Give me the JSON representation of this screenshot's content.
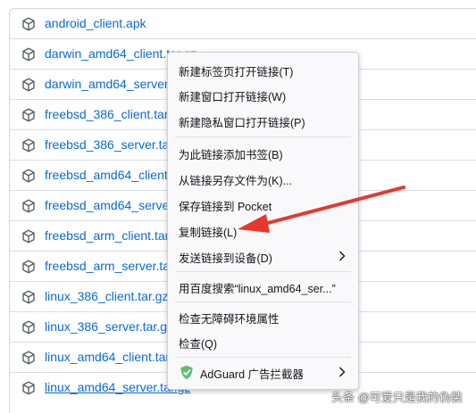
{
  "files": [
    {
      "name": "android_client.apk"
    },
    {
      "name": "darwin_amd64_client.tar.gz"
    },
    {
      "name": "darwin_amd64_server.tar.gz"
    },
    {
      "name": "freebsd_386_client.tar.gz"
    },
    {
      "name": "freebsd_386_server.tar.gz"
    },
    {
      "name": "freebsd_amd64_client.tar.gz"
    },
    {
      "name": "freebsd_amd64_server.tar.gz"
    },
    {
      "name": "freebsd_arm_client.tar.gz"
    },
    {
      "name": "freebsd_arm_server.tar.gz"
    },
    {
      "name": "linux_386_client.tar.gz"
    },
    {
      "name": "linux_386_server.tar.gz"
    },
    {
      "name": "linux_amd64_client.tar.gz"
    },
    {
      "name": "linux_amd64_server.tar.gz"
    }
  ],
  "context_menu": {
    "open_new_tab": "新建标签页打开链接(T)",
    "open_new_window": "新建窗口打开链接(W)",
    "open_private_window": "新建隐私窗口打开链接(P)",
    "bookmark_link": "为此链接添加书签(B)",
    "save_link_as": "从链接另存文件为(K)...",
    "save_to_pocket": "保存链接到 Pocket",
    "copy_link": "复制链接(L)",
    "send_to_device": "发送链接到设备(D)",
    "search_baidu": "用百度搜索“linux_amd64_ser...”",
    "inspect_accessibility": "检查无障碍环境属性",
    "inspect": "检查(Q)",
    "adguard": "AdGuard 广告拦截器"
  },
  "icons": {
    "file": "package-icon",
    "adguard": "shield-icon",
    "submenu": "chevron-right-icon"
  },
  "colors": {
    "link": "#0969da",
    "annotation_arrow": "#e8372c",
    "adguard_green": "#68bc71"
  },
  "watermark": "头条 @可爱只是我的伪装"
}
